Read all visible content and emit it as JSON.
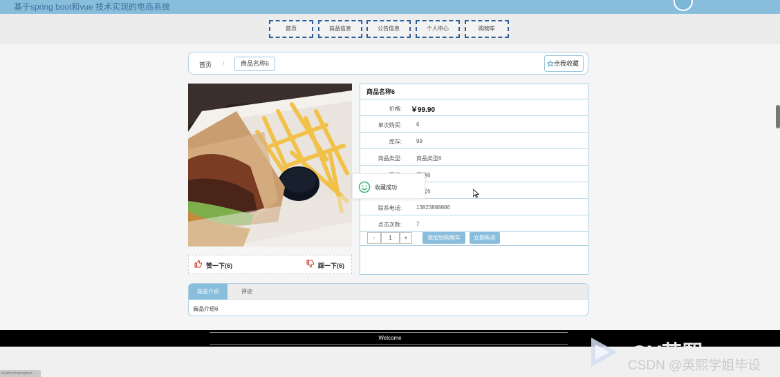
{
  "header": {
    "site_title": "基于spring boot和vue 技术实现的电商系统"
  },
  "nav": {
    "items": [
      "首页",
      "商品信息",
      "公告信息",
      "个人中心",
      "购物车"
    ]
  },
  "breadcrumb": {
    "home": "首页",
    "separator": "/",
    "current": "商品名称6",
    "favorite_label": "点我收藏"
  },
  "product": {
    "name": "商品名称6",
    "price_label": "价格:",
    "price_value": "￥99.90",
    "rows": [
      {
        "label": "单次购买:",
        "value": "6"
      },
      {
        "label": "库存:",
        "value": "99"
      },
      {
        "label": "商品类型:",
        "value": "商品类型6"
      },
      {
        "label": "规格:",
        "value": "规格6"
      },
      {
        "label": "",
        "value": "编号6"
      },
      {
        "label": "联系电话:",
        "value": "13823888886"
      },
      {
        "label": "点击次数:",
        "value": "7"
      }
    ],
    "qty_minus": "-",
    "qty_value": "1",
    "qty_plus": "+",
    "add_to_cart": "添加到购物车",
    "buy_now": "立即购买"
  },
  "votes": {
    "like": "赞一下(6)",
    "dislike": "踩一下(6)"
  },
  "toast": {
    "message": "收藏成功"
  },
  "tabs": {
    "intro": "商品介绍",
    "comments": "评论",
    "content": "商品介绍6"
  },
  "footer": {
    "text": "Welcome"
  },
  "watermark": {
    "top_text": "OV英熙",
    "text": "CSDN @英熙学姐毕设"
  },
  "status_bar": {
    "text": "localhost/springboot..."
  },
  "colors": {
    "header_bg": "#88bedc",
    "accent": "#88bedc",
    "border": "#a9d1e3",
    "nav_border": "#2f5f99",
    "footer_bg": "#000000"
  },
  "icons": {
    "favorite": "star-outline-icon",
    "like": "thumbs-up-icon",
    "dislike": "thumbs-down-icon",
    "toast": "smile-icon",
    "avatar": "avatar-circle"
  }
}
